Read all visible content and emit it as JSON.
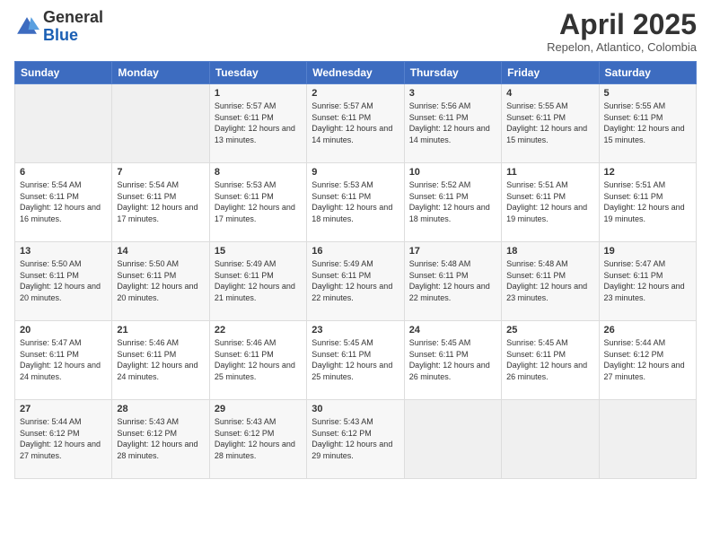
{
  "logo": {
    "general": "General",
    "blue": "Blue"
  },
  "header": {
    "title": "April 2025",
    "subtitle": "Repelon, Atlantico, Colombia"
  },
  "weekdays": [
    "Sunday",
    "Monday",
    "Tuesday",
    "Wednesday",
    "Thursday",
    "Friday",
    "Saturday"
  ],
  "weeks": [
    [
      {
        "day": "",
        "info": ""
      },
      {
        "day": "",
        "info": ""
      },
      {
        "day": "1",
        "info": "Sunrise: 5:57 AM\nSunset: 6:11 PM\nDaylight: 12 hours and 13 minutes."
      },
      {
        "day": "2",
        "info": "Sunrise: 5:57 AM\nSunset: 6:11 PM\nDaylight: 12 hours and 14 minutes."
      },
      {
        "day": "3",
        "info": "Sunrise: 5:56 AM\nSunset: 6:11 PM\nDaylight: 12 hours and 14 minutes."
      },
      {
        "day": "4",
        "info": "Sunrise: 5:55 AM\nSunset: 6:11 PM\nDaylight: 12 hours and 15 minutes."
      },
      {
        "day": "5",
        "info": "Sunrise: 5:55 AM\nSunset: 6:11 PM\nDaylight: 12 hours and 15 minutes."
      }
    ],
    [
      {
        "day": "6",
        "info": "Sunrise: 5:54 AM\nSunset: 6:11 PM\nDaylight: 12 hours and 16 minutes."
      },
      {
        "day": "7",
        "info": "Sunrise: 5:54 AM\nSunset: 6:11 PM\nDaylight: 12 hours and 17 minutes."
      },
      {
        "day": "8",
        "info": "Sunrise: 5:53 AM\nSunset: 6:11 PM\nDaylight: 12 hours and 17 minutes."
      },
      {
        "day": "9",
        "info": "Sunrise: 5:53 AM\nSunset: 6:11 PM\nDaylight: 12 hours and 18 minutes."
      },
      {
        "day": "10",
        "info": "Sunrise: 5:52 AM\nSunset: 6:11 PM\nDaylight: 12 hours and 18 minutes."
      },
      {
        "day": "11",
        "info": "Sunrise: 5:51 AM\nSunset: 6:11 PM\nDaylight: 12 hours and 19 minutes."
      },
      {
        "day": "12",
        "info": "Sunrise: 5:51 AM\nSunset: 6:11 PM\nDaylight: 12 hours and 19 minutes."
      }
    ],
    [
      {
        "day": "13",
        "info": "Sunrise: 5:50 AM\nSunset: 6:11 PM\nDaylight: 12 hours and 20 minutes."
      },
      {
        "day": "14",
        "info": "Sunrise: 5:50 AM\nSunset: 6:11 PM\nDaylight: 12 hours and 20 minutes."
      },
      {
        "day": "15",
        "info": "Sunrise: 5:49 AM\nSunset: 6:11 PM\nDaylight: 12 hours and 21 minutes."
      },
      {
        "day": "16",
        "info": "Sunrise: 5:49 AM\nSunset: 6:11 PM\nDaylight: 12 hours and 22 minutes."
      },
      {
        "day": "17",
        "info": "Sunrise: 5:48 AM\nSunset: 6:11 PM\nDaylight: 12 hours and 22 minutes."
      },
      {
        "day": "18",
        "info": "Sunrise: 5:48 AM\nSunset: 6:11 PM\nDaylight: 12 hours and 23 minutes."
      },
      {
        "day": "19",
        "info": "Sunrise: 5:47 AM\nSunset: 6:11 PM\nDaylight: 12 hours and 23 minutes."
      }
    ],
    [
      {
        "day": "20",
        "info": "Sunrise: 5:47 AM\nSunset: 6:11 PM\nDaylight: 12 hours and 24 minutes."
      },
      {
        "day": "21",
        "info": "Sunrise: 5:46 AM\nSunset: 6:11 PM\nDaylight: 12 hours and 24 minutes."
      },
      {
        "day": "22",
        "info": "Sunrise: 5:46 AM\nSunset: 6:11 PM\nDaylight: 12 hours and 25 minutes."
      },
      {
        "day": "23",
        "info": "Sunrise: 5:45 AM\nSunset: 6:11 PM\nDaylight: 12 hours and 25 minutes."
      },
      {
        "day": "24",
        "info": "Sunrise: 5:45 AM\nSunset: 6:11 PM\nDaylight: 12 hours and 26 minutes."
      },
      {
        "day": "25",
        "info": "Sunrise: 5:45 AM\nSunset: 6:11 PM\nDaylight: 12 hours and 26 minutes."
      },
      {
        "day": "26",
        "info": "Sunrise: 5:44 AM\nSunset: 6:12 PM\nDaylight: 12 hours and 27 minutes."
      }
    ],
    [
      {
        "day": "27",
        "info": "Sunrise: 5:44 AM\nSunset: 6:12 PM\nDaylight: 12 hours and 27 minutes."
      },
      {
        "day": "28",
        "info": "Sunrise: 5:43 AM\nSunset: 6:12 PM\nDaylight: 12 hours and 28 minutes."
      },
      {
        "day": "29",
        "info": "Sunrise: 5:43 AM\nSunset: 6:12 PM\nDaylight: 12 hours and 28 minutes."
      },
      {
        "day": "30",
        "info": "Sunrise: 5:43 AM\nSunset: 6:12 PM\nDaylight: 12 hours and 29 minutes."
      },
      {
        "day": "",
        "info": ""
      },
      {
        "day": "",
        "info": ""
      },
      {
        "day": "",
        "info": ""
      }
    ]
  ]
}
